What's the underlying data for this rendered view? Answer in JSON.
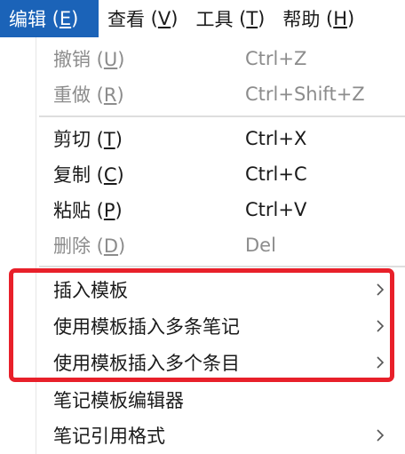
{
  "menubar": {
    "items": [
      {
        "label": "编辑",
        "accel": "E"
      },
      {
        "label": "查看",
        "accel": "V"
      },
      {
        "label": "工具",
        "accel": "T"
      },
      {
        "label": "帮助",
        "accel": "H"
      }
    ]
  },
  "menu": {
    "undo": {
      "label": "撤销",
      "accel": "U",
      "shortcut": "Ctrl+Z"
    },
    "redo": {
      "label": "重做",
      "accel": "R",
      "shortcut": "Ctrl+Shift+Z"
    },
    "cut": {
      "label": "剪切",
      "accel": "T",
      "shortcut": "Ctrl+X"
    },
    "copy": {
      "label": "复制",
      "accel": "C",
      "shortcut": "Ctrl+C"
    },
    "paste": {
      "label": "粘贴",
      "accel": "P",
      "shortcut": "Ctrl+V"
    },
    "delete": {
      "label": "删除",
      "accel": "D",
      "shortcut": "Del"
    },
    "insert_template": {
      "label": "插入模板",
      "icon": "chevron-right-icon"
    },
    "insert_multiple_notes": {
      "label": "使用模板插入多条笔记",
      "icon": "chevron-right-icon"
    },
    "insert_multiple_items": {
      "label": "使用模板插入多个条目",
      "icon": "chevron-right-icon"
    },
    "note_template_editor": {
      "label": "笔记模板编辑器"
    },
    "note_citation_format": {
      "label": "笔记引用格式",
      "icon": "chevron-right-icon"
    }
  },
  "colors": {
    "active_menu_bg": "#1b63b8",
    "disabled_text": "#8c8c8c",
    "highlight_border": "#e8202a"
  }
}
